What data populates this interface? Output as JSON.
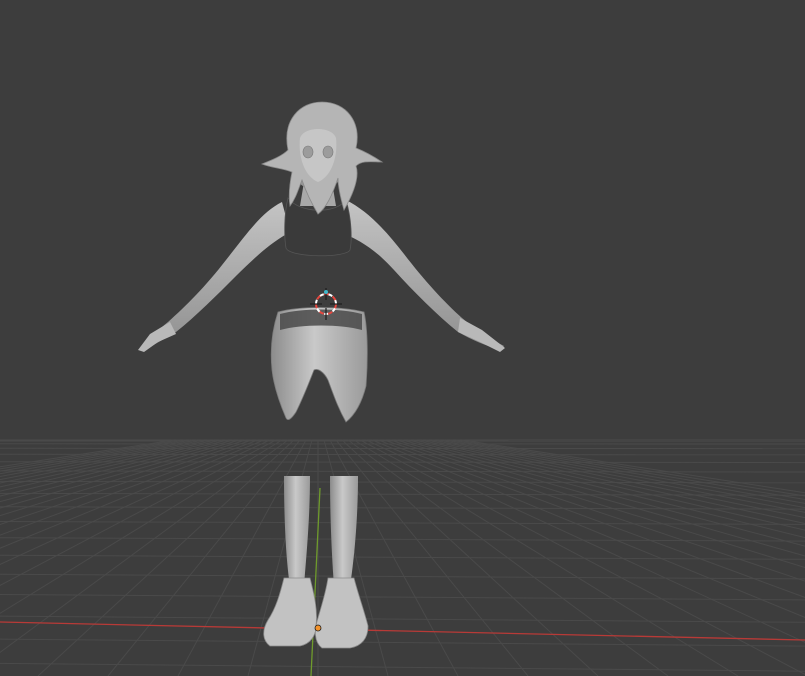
{
  "viewport": {
    "background": "#3d3d3d",
    "grid_color": "#4a4a4a",
    "x_axis_color": "#c3423f",
    "y_axis_color": "#6f9b2c",
    "mesh_color": "#bdbdbd",
    "mesh_shadow": "#8e8e8e",
    "cursor_colors": [
      "#e8473f",
      "#ffffff"
    ],
    "origin_color": "#f2922c"
  },
  "scene": {
    "object": "character-mesh",
    "cursor": "3d-cursor-icon",
    "origin": "object-origin-dot"
  }
}
